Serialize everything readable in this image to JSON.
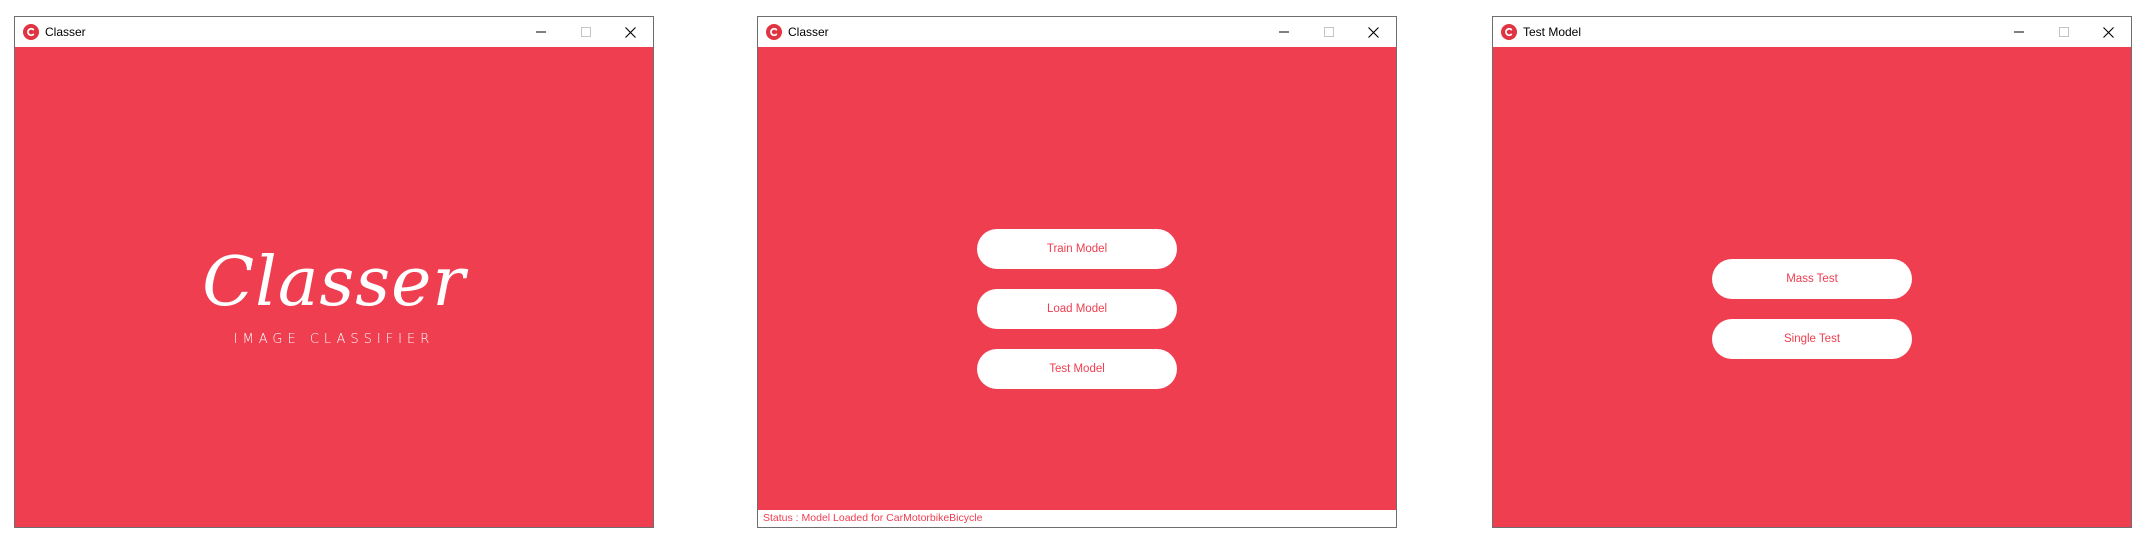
{
  "colors": {
    "accent": "#ee3e50",
    "surface": "#ffffff",
    "title_text": "#000000"
  },
  "windows": [
    {
      "title": "Classer",
      "icon": "app-logo-icon",
      "splash": {
        "logo": "Classer",
        "tagline": "IMAGE CLASSIFIER"
      }
    },
    {
      "title": "Classer",
      "icon": "app-logo-icon",
      "buttons": {
        "train": "Train Model",
        "load": "Load Model",
        "test": "Test Model"
      },
      "status": "Status : Model Loaded for CarMotorbikeBicycle"
    },
    {
      "title": "Test Model",
      "icon": "app-logo-icon",
      "buttons": {
        "mass": "Mass Test",
        "single": "Single Test"
      }
    }
  ]
}
